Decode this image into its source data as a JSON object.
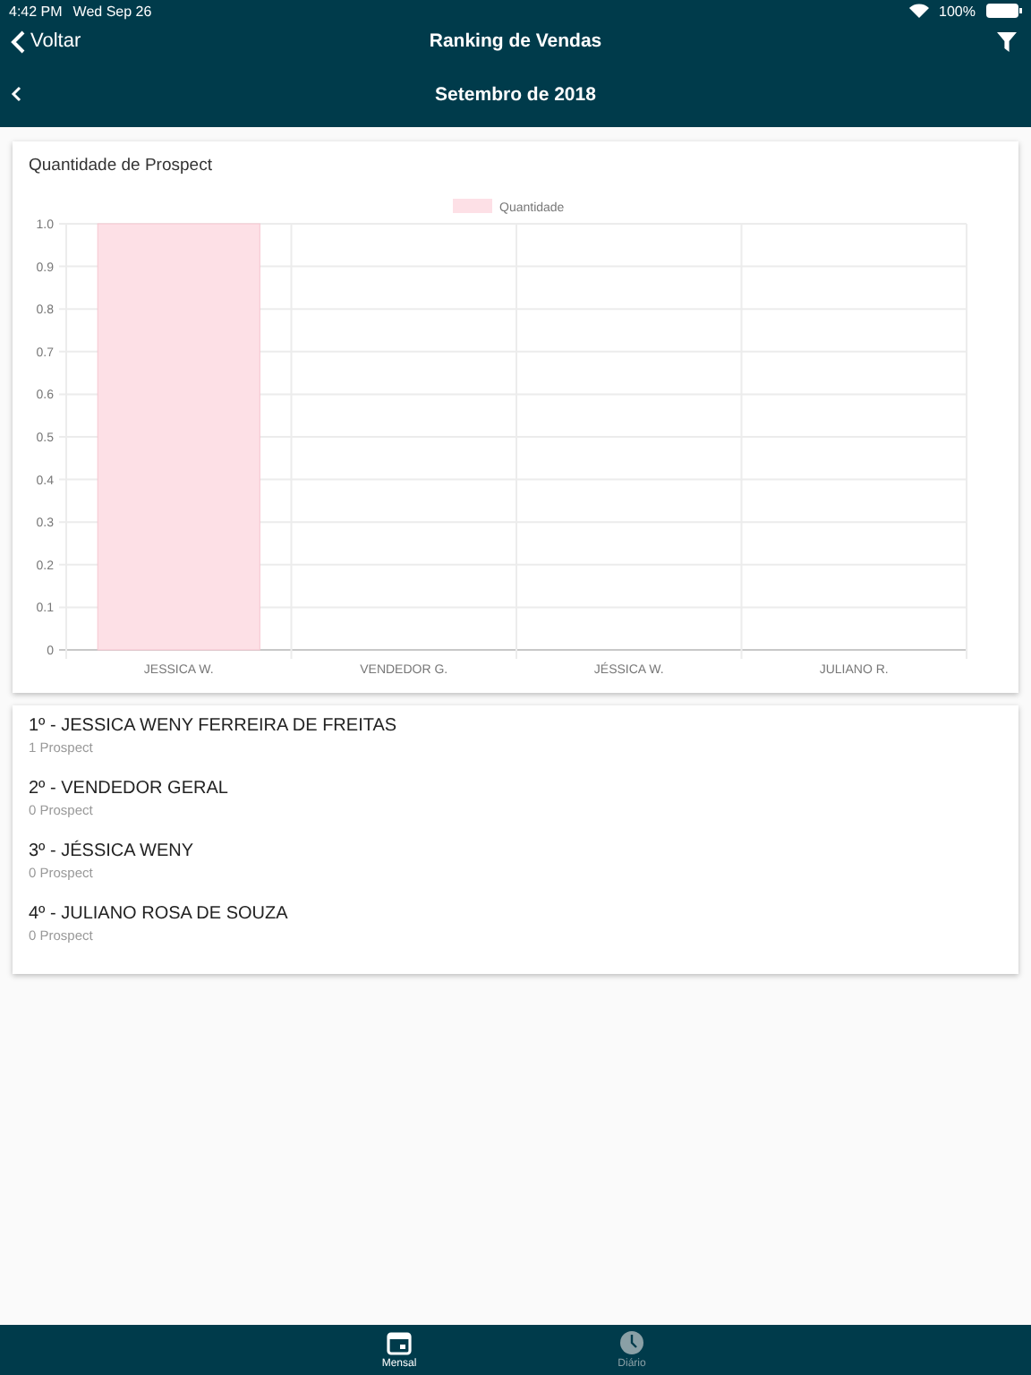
{
  "status_bar": {
    "time": "4:42 PM",
    "date": "Wed Sep 26",
    "battery": "100%"
  },
  "nav": {
    "back_label": "Voltar",
    "title": "Ranking de Vendas"
  },
  "period": {
    "label": "Setembro de 2018"
  },
  "chart": {
    "title": "Quantidade de Prospect",
    "chart_data": {
      "type": "bar",
      "categories": [
        "JESSICA W.",
        "VENDEDOR G.",
        "JÉSSICA W.",
        "JULIANO R."
      ],
      "series": [
        {
          "name": "Quantidade",
          "color": "#fde0e6",
          "values": [
            1,
            0,
            0,
            0
          ]
        }
      ],
      "ylim": [
        0,
        1
      ],
      "grid": true,
      "yticks": [
        0,
        0.1,
        0.2,
        0.3,
        0.4,
        0.5,
        0.6,
        0.7,
        0.8,
        0.9,
        {
          "value": 1,
          "label": "1.0"
        }
      ]
    }
  },
  "ranking": [
    {
      "name": "1º - JESSICA WENY FERREIRA DE FREITAS",
      "count": "1 Prospect"
    },
    {
      "name": "2º - VENDEDOR GERAL",
      "count": "0 Prospect"
    },
    {
      "name": "3º - JÉSSICA WENY",
      "count": "0 Prospect"
    },
    {
      "name": "4º - JULIANO ROSA DE SOUZA",
      "count": "0 Prospect"
    }
  ],
  "tabs": [
    {
      "label": "Mensal",
      "kind": "calendar",
      "selected": true
    },
    {
      "label": "Diário",
      "kind": "clock",
      "selected": false
    }
  ]
}
